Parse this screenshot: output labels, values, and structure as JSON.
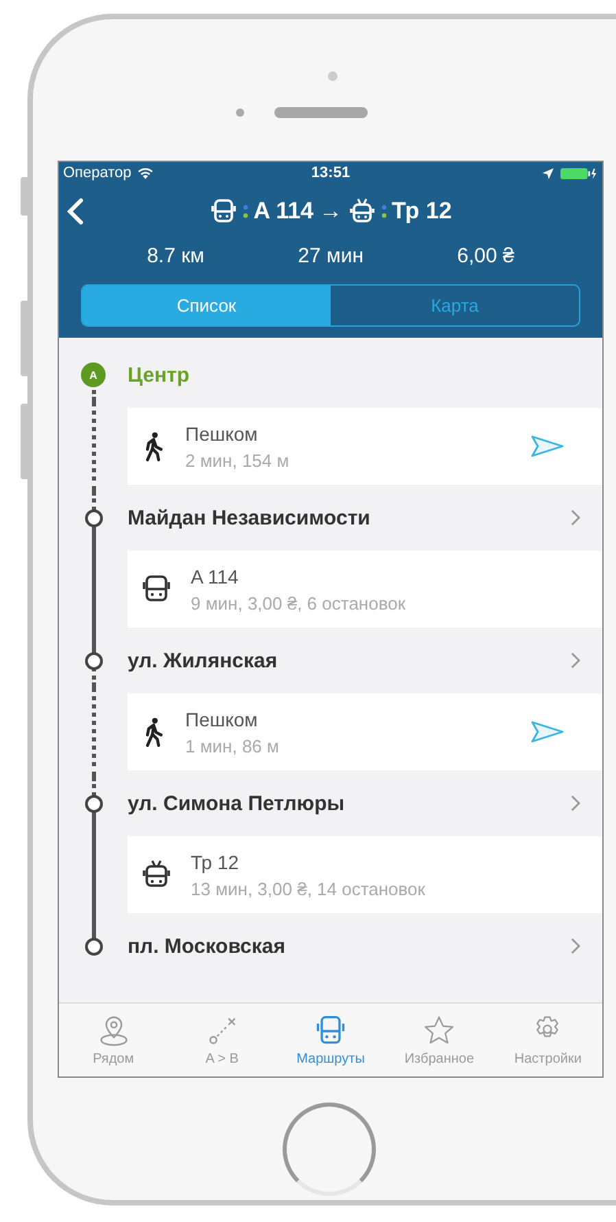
{
  "status_bar": {
    "carrier": "Оператор",
    "time": "13:51"
  },
  "header": {
    "from_route": "A 114",
    "arrow": "→",
    "to_route": "Тр 12"
  },
  "summary": [
    "8.7 км",
    "27 мин",
    "6,00 ₴"
  ],
  "segments": [
    {
      "label": "Список",
      "selected": true
    },
    {
      "label": "Карта",
      "selected": false
    }
  ],
  "steps": [
    {
      "kind": "origin",
      "marker": "A",
      "name": "Центр"
    },
    {
      "kind": "walk",
      "title": "Пешком",
      "detail": "2 мин, 154 м"
    },
    {
      "kind": "stop",
      "name": "Майдан Независимости"
    },
    {
      "kind": "bus",
      "title": "A 114",
      "detail": "9 мин, 3,00 ₴, 6 остановок"
    },
    {
      "kind": "stop",
      "name": "ул. Жилянская"
    },
    {
      "kind": "walk",
      "title": "Пешком",
      "detail": "1 мин, 86 м"
    },
    {
      "kind": "stop",
      "name": "ул. Симона Петлюры"
    },
    {
      "kind": "trolleybus",
      "title": "Тр 12",
      "detail": "13 мин, 3,00 ₴, 14 остановок"
    },
    {
      "kind": "stop",
      "name": "пл. Московская"
    }
  ],
  "tab_bar": [
    {
      "kind": "nearby",
      "label": "Рядом",
      "selected": false
    },
    {
      "kind": "ab",
      "label": "A > B",
      "selected": false
    },
    {
      "kind": "routes",
      "label": "Маршруты",
      "selected": true
    },
    {
      "kind": "favorites",
      "label": "Избранное",
      "selected": false
    },
    {
      "kind": "settings",
      "label": "Настройки",
      "selected": false
    }
  ]
}
